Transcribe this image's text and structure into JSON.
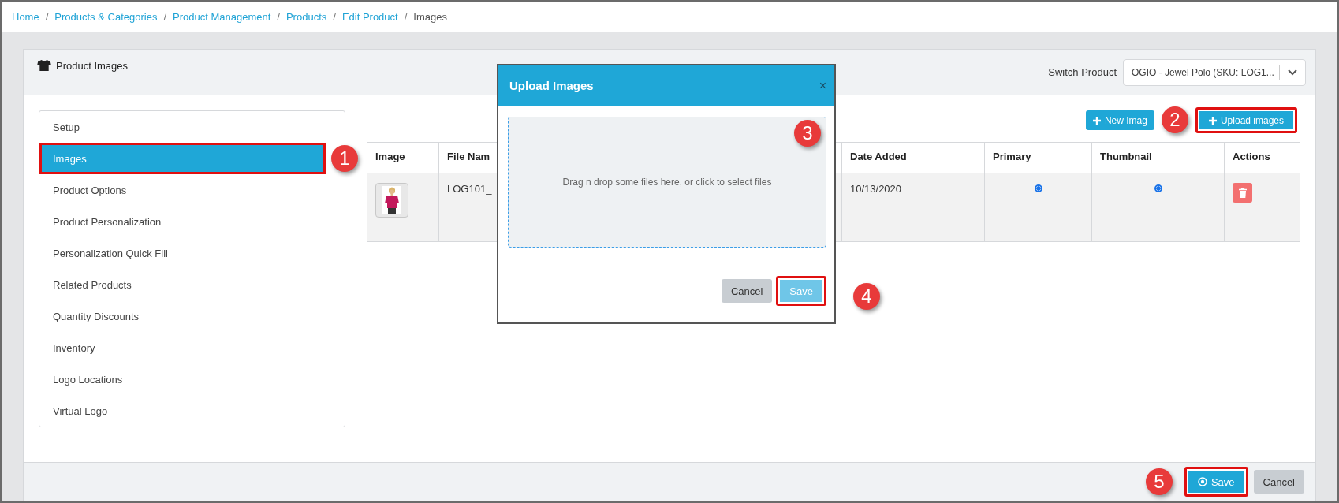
{
  "breadcrumb": {
    "separator": "/",
    "items": [
      {
        "label": "Home",
        "link": true
      },
      {
        "label": "Products & Categories",
        "link": true
      },
      {
        "label": "Product Management",
        "link": true
      },
      {
        "label": "Products",
        "link": true
      },
      {
        "label": "Edit Product",
        "link": true
      },
      {
        "label": "Images",
        "link": false
      }
    ]
  },
  "card": {
    "title": "Product Images",
    "switch_label": "Switch Product",
    "switch_value": "OGIO - Jewel Polo (SKU: LOG1..."
  },
  "sidebar": {
    "items": [
      {
        "label": "Setup",
        "selected": false,
        "highlighted": false
      },
      {
        "label": "Images",
        "selected": true,
        "highlighted": true,
        "callout": "1"
      },
      {
        "label": "Product Options",
        "selected": false,
        "highlighted": false
      },
      {
        "label": "Product Personalization",
        "selected": false,
        "highlighted": false
      },
      {
        "label": "Personalization Quick Fill",
        "selected": false,
        "highlighted": false
      },
      {
        "label": "Related Products",
        "selected": false,
        "highlighted": false
      },
      {
        "label": "Quantity Discounts",
        "selected": false,
        "highlighted": false
      },
      {
        "label": "Inventory",
        "selected": false,
        "highlighted": false
      },
      {
        "label": "Logo Locations",
        "selected": false,
        "highlighted": false
      },
      {
        "label": "Virtual Logo",
        "selected": false,
        "highlighted": false
      }
    ]
  },
  "toolbar": {
    "buttons": [
      {
        "label": "New Imag",
        "highlighted": false
      },
      {
        "label": "Upload images",
        "highlighted": true,
        "callout": "2"
      }
    ]
  },
  "table": {
    "columns": [
      "Image",
      "File Nam",
      "Date Added",
      "Primary",
      "Thumbnail",
      "Actions"
    ],
    "rows": [
      {
        "file_name": "LOG101_",
        "date_added": "10/13/2020",
        "primary": true,
        "thumbnail": true
      }
    ]
  },
  "modal": {
    "title": "Upload Images",
    "close": "×",
    "dropzone_text": "Drag n drop some files here, or click to select files",
    "dropzone_callout": "3",
    "buttons": [
      {
        "label": "Cancel",
        "kind": "secondary",
        "highlighted": false
      },
      {
        "label": "Save",
        "kind": "light",
        "highlighted": true,
        "callout": "4"
      }
    ]
  },
  "footer": {
    "buttons": [
      {
        "label": "Save",
        "kind": "save",
        "highlighted": true,
        "callout": "5"
      },
      {
        "label": "Cancel",
        "kind": "secondary",
        "highlighted": false
      }
    ]
  }
}
